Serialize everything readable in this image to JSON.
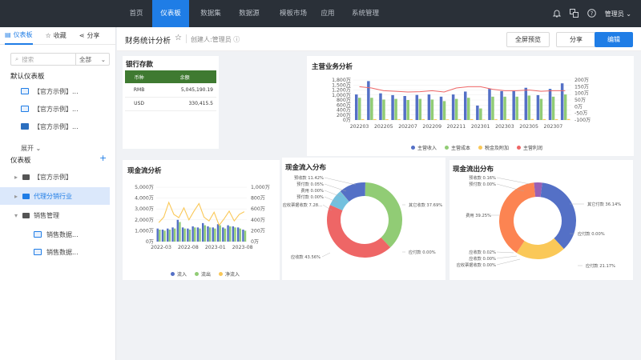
{
  "nav": {
    "items": [
      "首页",
      "仪表板",
      "数据集",
      "数据源",
      "模板市场",
      "应用",
      "系统管理"
    ],
    "active": 1,
    "user": "管理员"
  },
  "sidebar": {
    "tabs": [
      "仪表板",
      "收藏",
      "分享"
    ],
    "search_placeholder": "搜索",
    "search_scope": "全部",
    "default_title": "默认仪表板",
    "default_items": [
      "【官方示例】...",
      "【官方示例】...",
      "【官方示例】..."
    ],
    "expand_label": "展开",
    "section_title": "仪表板",
    "tree": [
      {
        "label": "【官方示例】",
        "type": "folder"
      },
      {
        "label": "代理分销行业",
        "type": "folder",
        "selected": true
      },
      {
        "label": "销售管理",
        "type": "folder",
        "expanded": true
      },
      {
        "label": "销售数据...",
        "type": "dashboard"
      },
      {
        "label": "销售数据...",
        "type": "dashboard"
      }
    ]
  },
  "header": {
    "title": "财务统计分析",
    "creator": "创建人:管理员",
    "buttons": {
      "preview": "全屏预览",
      "share": "分享",
      "edit": "编辑"
    }
  },
  "bank": {
    "title": "银行存款",
    "columns": [
      "币种",
      "余额"
    ],
    "rows": [
      [
        "RMB",
        "5,045,190.19"
      ],
      [
        "USD",
        "330,415.5"
      ]
    ]
  },
  "colors": {
    "blue": "#5470c6",
    "green": "#91cc75",
    "yellow": "#fac858",
    "red": "#ee6666",
    "lightblue": "#73c0de",
    "orange": "#fc8452",
    "purple": "#9a60b4",
    "accent": "#1f7de6"
  },
  "chart_data": [
    {
      "id": "main_business",
      "type": "bar+line",
      "title": "主营业务分析",
      "categories": [
        "202203",
        "202204",
        "202205",
        "202206",
        "202207",
        "202208",
        "202209",
        "202210",
        "202211",
        "202212",
        "202301",
        "202302",
        "202303",
        "202304",
        "202305",
        "202306",
        "202307",
        "202308"
      ],
      "x_tick_labels": [
        "202203",
        "202205",
        "202207",
        "202209",
        "202211",
        "202301",
        "202303",
        "202305",
        "202307"
      ],
      "y_left_ticks": [
        "0万",
        "200万",
        "400万",
        "600万",
        "800万",
        "1,000万",
        "1,200万",
        "1,500万",
        "1,800万"
      ],
      "y_right_ticks": [
        "-100万",
        "-50万",
        "0万",
        "50万",
        "100万",
        "150万",
        "200万"
      ],
      "series": [
        {
          "name": "主营收入",
          "type": "bar",
          "axis": "left",
          "values": [
            1150,
            1750,
            1200,
            1120,
            1080,
            1130,
            1150,
            1050,
            1150,
            1280,
            650,
            1400,
            1300,
            1300,
            1450,
            1120,
            1400,
            1650
          ]
        },
        {
          "name": "主营成本",
          "type": "bar",
          "axis": "left",
          "values": [
            1000,
            1000,
            920,
            950,
            900,
            950,
            920,
            850,
            950,
            1000,
            520,
            1050,
            1050,
            1050,
            1100,
            950,
            1050,
            1150
          ]
        },
        {
          "name": "税金及附加",
          "type": "bar",
          "axis": "left",
          "values": [
            40,
            40,
            35,
            40,
            35,
            40,
            35,
            30,
            40,
            40,
            20,
            40,
            40,
            40,
            45,
            40,
            40,
            45
          ]
        },
        {
          "name": "主营利润",
          "type": "line",
          "axis": "right",
          "values": [
            150,
            140,
            120,
            115,
            110,
            112,
            120,
            110,
            140,
            150,
            150,
            130,
            120,
            120,
            125,
            115,
            120,
            120
          ]
        }
      ]
    },
    {
      "id": "cashflow",
      "type": "bar+line",
      "title": "现金流分析",
      "x_tick_labels": [
        "2022-03",
        "2022-08",
        "2023-01",
        "2023-08"
      ],
      "y_left_ticks": [
        "0万",
        "1,000万",
        "2,000万",
        "3,000万",
        "4,000万",
        "5,000万"
      ],
      "y_right_ticks": [
        "0万",
        "200万",
        "400万",
        "600万",
        "800万",
        "1,000万"
      ],
      "series": [
        {
          "name": "流入",
          "type": "bar",
          "axis": "left",
          "values": [
            1200,
            1100,
            1200,
            1300,
            2000,
            1300,
            1200,
            1400,
            1300,
            1700,
            1400,
            1300,
            1600,
            1300,
            1500,
            1400,
            1300,
            1100
          ]
        },
        {
          "name": "流出",
          "type": "bar",
          "axis": "left",
          "values": [
            1100,
            1000,
            1100,
            1200,
            1800,
            1200,
            1100,
            1300,
            1200,
            1500,
            1300,
            1200,
            1500,
            1200,
            1400,
            1300,
            1200,
            1000
          ]
        },
        {
          "name": "净流入",
          "type": "line",
          "axis": "right",
          "values": [
            350,
            450,
            720,
            500,
            440,
            620,
            400,
            560,
            700,
            450,
            380,
            540,
            300,
            420,
            560,
            380,
            500,
            550
          ]
        }
      ]
    },
    {
      "id": "inflow_dist",
      "type": "pie",
      "title": "现金流入分布",
      "slices": [
        {
          "label": "其它收款 37.69%",
          "value": 37.69
        },
        {
          "label": "应付款 0.00%",
          "value": 0.0
        },
        {
          "label": "应收款 43.56%",
          "value": 43.56
        },
        {
          "label": "应收票据收款 7.28...",
          "value": 7.28
        },
        {
          "label": "预付款 0.00%",
          "value": 0.0
        },
        {
          "label": "费用 0.00%",
          "value": 0.0
        },
        {
          "label": "预付款 0.05%",
          "value": 0.05
        },
        {
          "label": "预收款 11.42%",
          "value": 11.42
        }
      ]
    },
    {
      "id": "outflow_dist",
      "type": "pie",
      "title": "现金流出分布",
      "slices": [
        {
          "label": "其它付款 36.14%",
          "value": 36.14
        },
        {
          "label": "应付款 0.00%",
          "value": 0.0
        },
        {
          "label": "应付款 21.17%",
          "value": 21.17
        },
        {
          "label": "应收票据收款 0.00%",
          "value": 0.0
        },
        {
          "label": "应收款 0.00%",
          "value": 0.0
        },
        {
          "label": "应收款 0.02%",
          "value": 0.02
        },
        {
          "label": "费用 39.25%",
          "value": 39.25
        },
        {
          "label": "预付款 0.00%",
          "value": 0.0
        },
        {
          "label": "预收款 0.16%",
          "value": 3.42
        }
      ]
    }
  ]
}
